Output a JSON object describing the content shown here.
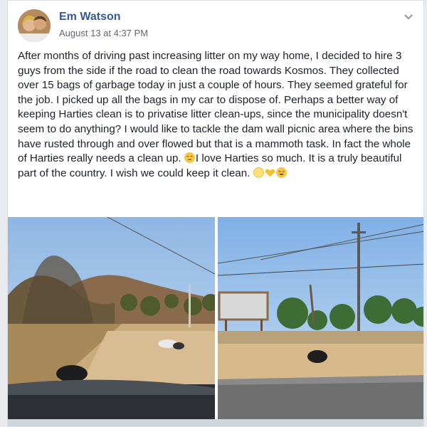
{
  "post": {
    "author": "Em Watson",
    "timestamp": "August 13 at 4:37 PM",
    "text_part1": "After months of driving past increasing litter on my way home, I decided to hire 3 guys from the side if the road to clean the road towards Kosmos. They collected over 15 bags of garbage today in just a couple of hours. They seemed grateful for the job. I picked up all the bags in my car to dispose of. Perhaps a better way of keeping Harties clean is to privatise litter clean-ups, since the municipality doesn't seem to do anything? I would like to tackle the dam wall picnic area where the bins have rusted through and over flowed but that is a mammoth task. In fact the whole of Harties really needs a clean up.",
    "text_part2": "I love Harties so much. It is a truly beautiful part of the country. I wish we could keep it clean."
  },
  "icons": {
    "menu": "chevron-down-icon",
    "emoji_sad": "relieved-face-emoji",
    "emoji_blush": "smiling-face-emoji",
    "emoji_heart": "yellow-heart-emoji",
    "emoji_smile": "smiling-eyes-emoji"
  },
  "colors": {
    "author_link": "#365899",
    "meta_text": "#616770",
    "body_text": "#1d2129"
  }
}
